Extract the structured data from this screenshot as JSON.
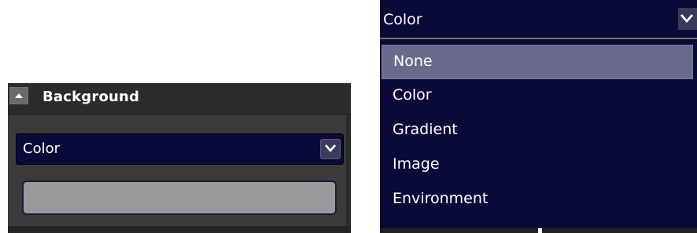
{
  "left_panel": {
    "title": "Background",
    "select": {
      "value": "Color"
    },
    "swatch_color": "#9a9a9a"
  },
  "right_dropdown": {
    "value": "Color",
    "options": [
      "None",
      "Color",
      "Gradient",
      "Image",
      "Environment"
    ],
    "highlighted": "None"
  },
  "colors": {
    "panel_bg": "#3b3b3b",
    "dropdown_bg": "#0a0a38",
    "highlight": "#6a6a8c"
  }
}
